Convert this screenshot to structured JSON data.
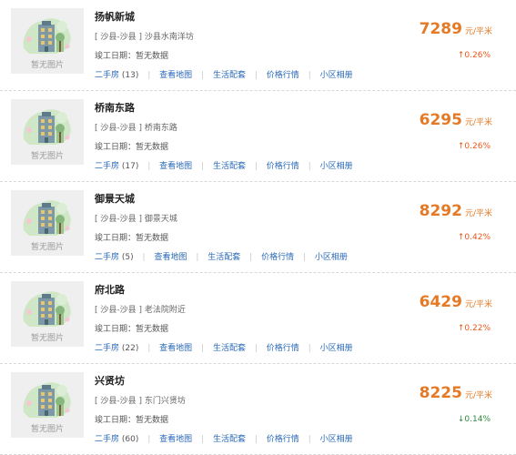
{
  "listings": [
    {
      "name": "扬帆新城",
      "address": "[ 沙县-沙县 ] 沙县水南洋坊",
      "completion": "竣工日期：暂无数据",
      "price": "7289",
      "unit": "元/平米",
      "change_arrow": "↑",
      "change": "0.26%",
      "trend": "up",
      "resale_label": "二手房",
      "resale_count": "(13)",
      "image_text": "暂无图片"
    },
    {
      "name": "桥南东路",
      "address": "[ 沙县-沙县 ] 桥南东路",
      "completion": "竣工日期：暂无数据",
      "price": "6295",
      "unit": "元/平米",
      "change_arrow": "↑",
      "change": "0.26%",
      "trend": "up",
      "resale_label": "二手房",
      "resale_count": "(17)",
      "image_text": "暂无图片"
    },
    {
      "name": "御景天城",
      "address": "[ 沙县-沙县 ] 御景天城",
      "completion": "竣工日期：暂无数据",
      "price": "8292",
      "unit": "元/平米",
      "change_arrow": "↑",
      "change": "0.42%",
      "trend": "up",
      "resale_label": "二手房",
      "resale_count": "(5)",
      "image_text": "暂无图片"
    },
    {
      "name": "府北路",
      "address": "[ 沙县-沙县 ] 老法院附近",
      "completion": "竣工日期：暂无数据",
      "price": "6429",
      "unit": "元/平米",
      "change_arrow": "↑",
      "change": "0.22%",
      "trend": "up",
      "resale_label": "二手房",
      "resale_count": "(22)",
      "image_text": "暂无图片"
    },
    {
      "name": "兴贤坊",
      "address": "[ 沙县-沙县 ] 东门兴贤坊",
      "completion": "竣工日期：暂无数据",
      "price": "8225",
      "unit": "元/平米",
      "change_arrow": "↓",
      "change": "0.14%",
      "trend": "down",
      "resale_label": "二手房",
      "resale_count": "(60)",
      "image_text": "暂无图片"
    }
  ],
  "links": {
    "map": "查看地图",
    "amenities": "生活配套",
    "price_trend": "价格行情",
    "album": "小区相册"
  },
  "colors": {
    "price": "#e57a26",
    "up": "#e8561b",
    "down": "#2e8b3e",
    "link": "#2a6ab8"
  },
  "icons": {
    "placeholder": "building-placeholder-icon"
  }
}
